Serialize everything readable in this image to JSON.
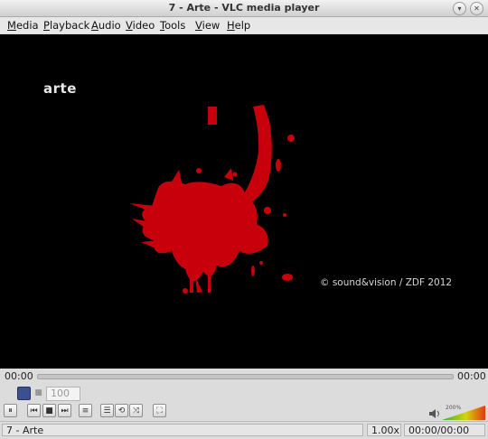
{
  "window": {
    "title": "7 - Arte - VLC media player"
  },
  "menu": [
    "Media",
    "Playback",
    "Audio",
    "Video",
    "Tools",
    "View",
    "Help"
  ],
  "video": {
    "channel_logo": "arte",
    "credit": "© sound&vision /  ZDF 2012"
  },
  "seek": {
    "elapsed": "00:00",
    "total": "00:00",
    "progress": 0
  },
  "spin": {
    "value": "100"
  },
  "volume": {
    "level_label": "200%"
  },
  "status": {
    "media": "7 - Arte",
    "speed": "1.00x",
    "time": "00:00/00:00"
  },
  "icons": {
    "minimize": "▾",
    "close": "✕",
    "play_pause": "⏸",
    "prev": "⏮",
    "stop": "■",
    "next": "⏭",
    "equalizer": "≡",
    "playlist": "☰",
    "loop": "⟲",
    "shuffle": "⤨",
    "fullscreen": "⛶"
  }
}
